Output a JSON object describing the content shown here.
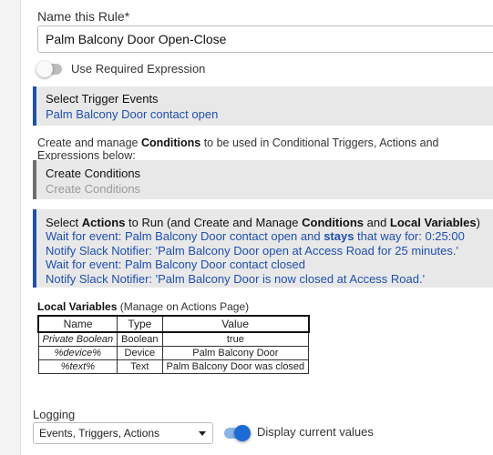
{
  "rule_name": {
    "label": "Name this Rule*",
    "value": "Palm Balcony Door Open-Close"
  },
  "required_expression": {
    "label": "Use Required Expression",
    "enabled": false
  },
  "trigger": {
    "title": "Select Trigger Events",
    "events": [
      "Palm Balcony Door contact open"
    ]
  },
  "conditions_desc": {
    "prefix": "Create and manage ",
    "bold": "Conditions",
    "suffix": " to be used in Conditional Triggers, Actions and Expressions below:"
  },
  "conditions": {
    "title": "Create Conditions",
    "subtitle": "Create Conditions"
  },
  "actions": {
    "title_parts": [
      "Select ",
      "Actions",
      " to Run (and Create and Manage ",
      "Conditions",
      " and ",
      "Local Variables",
      ")"
    ],
    "line1_pre": "Wait for event: Palm Balcony Door contact open and ",
    "line1_bold": "stays",
    "line1_post": " that way for: 0:25:00",
    "line2": "Notify Slack Notifier: 'Palm Balcony Door open at Access Road for 25 minutes.'",
    "line3": "Wait for event: Palm Balcony Door contact closed",
    "line4": "Notify Slack Notifier: 'Palm Balcony Door is now closed at Access Road.'"
  },
  "local_variables": {
    "title_bold": "Local Variables",
    "title_rest": " (Manage on Actions Page)",
    "headers": [
      "Name",
      "Type",
      "Value"
    ],
    "rows": [
      {
        "name": "Private Boolean",
        "type": "Boolean",
        "value": "true"
      },
      {
        "name": "%device%",
        "type": "Device",
        "value": "Palm Balcony Door"
      },
      {
        "name": "%text%",
        "type": "Text",
        "value": "Palm Balcony Door was closed"
      }
    ]
  },
  "logging": {
    "label": "Logging",
    "selected": "Events, Triggers, Actions",
    "display_current_values_label": "Display current values",
    "display_current_values": true
  },
  "colors": {
    "accent_blue": "#1e4fb4",
    "link_blue": "#1f4fb3",
    "toggle_on": "#1e6bd6"
  }
}
